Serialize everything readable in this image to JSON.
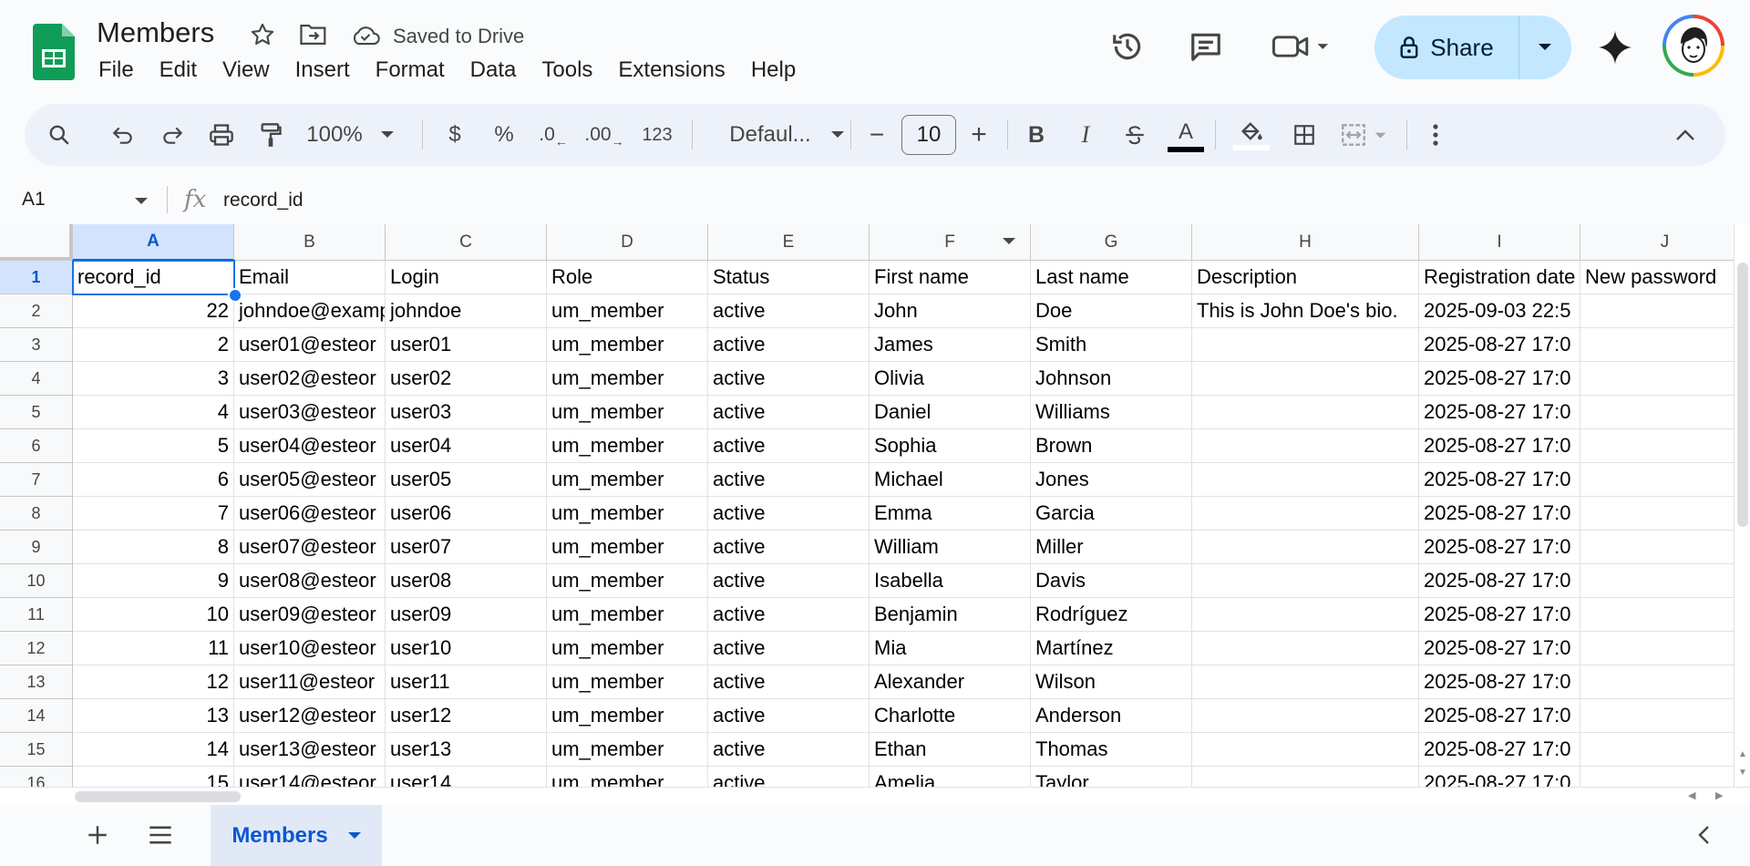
{
  "app": {
    "title": "Members",
    "saved_status": "Saved to Drive",
    "menu": [
      "File",
      "Edit",
      "View",
      "Insert",
      "Format",
      "Data",
      "Tools",
      "Extensions",
      "Help"
    ],
    "share_label": "Share",
    "brand_color": "#0f9d58",
    "accent": "#0b57d0"
  },
  "toolbar": {
    "zoom": "100%",
    "currency": "$",
    "percent": "%",
    "dec_decrease": ".0",
    "dec_increase": ".00",
    "number_format": "123",
    "font": "Defaul...",
    "font_size": "10",
    "minus": "−",
    "plus": "+",
    "bold": "B",
    "italic": "I",
    "text_color": "A"
  },
  "formula_bar": {
    "cell_ref": "A1",
    "fx": "fx",
    "value": "record_id"
  },
  "columns": [
    "A",
    "B",
    "C",
    "D",
    "E",
    "F",
    "G",
    "H",
    "I",
    "J"
  ],
  "rows": [
    [
      "record_id",
      "Email",
      "Login",
      "Role",
      "Status",
      "First name",
      "Last name",
      "Description",
      "Registration date",
      "New password"
    ],
    [
      "22",
      "johndoe@example.com",
      "johndoe",
      "um_member",
      "active",
      "John",
      "Doe",
      "This is John Doe's bio.",
      "2025-09-03 22:5",
      ""
    ],
    [
      "2",
      "user01@esteor",
      "user01",
      "um_member",
      "active",
      "James",
      "Smith",
      "",
      "2025-08-27 17:0",
      ""
    ],
    [
      "3",
      "user02@esteor",
      "user02",
      "um_member",
      "active",
      "Olivia",
      "Johnson",
      "",
      "2025-08-27 17:0",
      ""
    ],
    [
      "4",
      "user03@esteor",
      "user03",
      "um_member",
      "active",
      "Daniel",
      "Williams",
      "",
      "2025-08-27 17:0",
      ""
    ],
    [
      "5",
      "user04@esteor",
      "user04",
      "um_member",
      "active",
      "Sophia",
      "Brown",
      "",
      "2025-08-27 17:0",
      ""
    ],
    [
      "6",
      "user05@esteor",
      "user05",
      "um_member",
      "active",
      "Michael",
      "Jones",
      "",
      "2025-08-27 17:0",
      ""
    ],
    [
      "7",
      "user06@esteor",
      "user06",
      "um_member",
      "active",
      "Emma",
      "Garcia",
      "",
      "2025-08-27 17:0",
      ""
    ],
    [
      "8",
      "user07@esteor",
      "user07",
      "um_member",
      "active",
      "William",
      "Miller",
      "",
      "2025-08-27 17:0",
      ""
    ],
    [
      "9",
      "user08@esteor",
      "user08",
      "um_member",
      "active",
      "Isabella",
      "Davis",
      "",
      "2025-08-27 17:0",
      ""
    ],
    [
      "10",
      "user09@esteor",
      "user09",
      "um_member",
      "active",
      "Benjamin",
      "Rodríguez",
      "",
      "2025-08-27 17:0",
      ""
    ],
    [
      "11",
      "user10@esteor",
      "user10",
      "um_member",
      "active",
      "Mia",
      "Martínez",
      "",
      "2025-08-27 17:0",
      ""
    ],
    [
      "12",
      "user11@esteor",
      "user11",
      "um_member",
      "active",
      "Alexander",
      "Wilson",
      "",
      "2025-08-27 17:0",
      ""
    ],
    [
      "13",
      "user12@esteor",
      "user12",
      "um_member",
      "active",
      "Charlotte",
      "Anderson",
      "",
      "2025-08-27 17:0",
      ""
    ],
    [
      "14",
      "user13@esteor",
      "user13",
      "um_member",
      "active",
      "Ethan",
      "Thomas",
      "",
      "2025-08-27 17:0",
      ""
    ],
    [
      "15",
      "user14@esteor",
      "user14",
      "um_member",
      "active",
      "Amelia",
      "Taylor",
      "",
      "2025-08-27 17:0",
      ""
    ]
  ],
  "row_numbers": [
    "1",
    "2",
    "3",
    "4",
    "5",
    "6",
    "7",
    "8",
    "9",
    "10",
    "11",
    "12",
    "13",
    "14",
    "15",
    "16"
  ],
  "sheet_tabs": [
    "Members"
  ],
  "icons": {
    "sheets_logo": "sheets-logo-icon",
    "star": "star-icon",
    "move": "move-to-folder-icon",
    "cloud": "cloud-saved-icon",
    "history": "history-icon",
    "comment": "comment-icon",
    "meet": "video-call-icon",
    "lock": "lock-icon",
    "gemini": "gemini-sparkle-icon"
  }
}
